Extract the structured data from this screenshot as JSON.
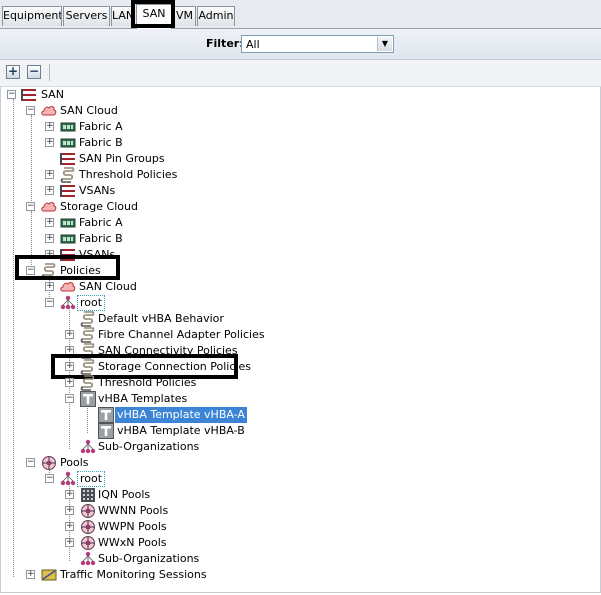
{
  "tabs": [
    {
      "label": "Equipment"
    },
    {
      "label": "Servers"
    },
    {
      "label": "LAN"
    },
    {
      "label": "SAN"
    },
    {
      "label": "VM"
    },
    {
      "label": "Admin"
    }
  ],
  "active_tab": "SAN",
  "filter": {
    "label": "Filter:",
    "value": "All"
  },
  "toolbar": {
    "expand_label": "+",
    "collapse_label": "−"
  },
  "tree": {
    "san": "SAN",
    "san_cloud": "SAN Cloud",
    "fabric_a": "Fabric A",
    "fabric_b": "Fabric B",
    "san_pin_groups": "SAN Pin Groups",
    "threshold_policies": "Threshold Policies",
    "vsans": "VSANs",
    "storage_cloud": "Storage Cloud",
    "sc_fabric_a": "Fabric A",
    "sc_fabric_b": "Fabric B",
    "sc_vsans": "VSANs",
    "policies": "Policies",
    "pol_san_cloud": "SAN Cloud",
    "pol_root": "root",
    "default_vhba": "Default vHBA Behavior",
    "fc_adapter": "Fibre Channel Adapter Policies",
    "san_conn": "SAN Connectivity Policies",
    "storage_conn": "Storage Connection Policies",
    "pol_threshold": "Threshold Policies",
    "vhba_templates": "vHBA Templates",
    "vhba_a": "vHBA Template vHBA-A",
    "vhba_b": "vHBA Template vHBA-B",
    "pol_suborgs": "Sub-Organizations",
    "pools": "Pools",
    "pools_root": "root",
    "iqn": "IQN Pools",
    "wwnn": "WWNN Pools",
    "wwpn": "WWPN Pools",
    "wwxn": "WWxN Pools",
    "pools_suborgs": "Sub-Organizations",
    "traffic": "Traffic Monitoring Sessions"
  }
}
